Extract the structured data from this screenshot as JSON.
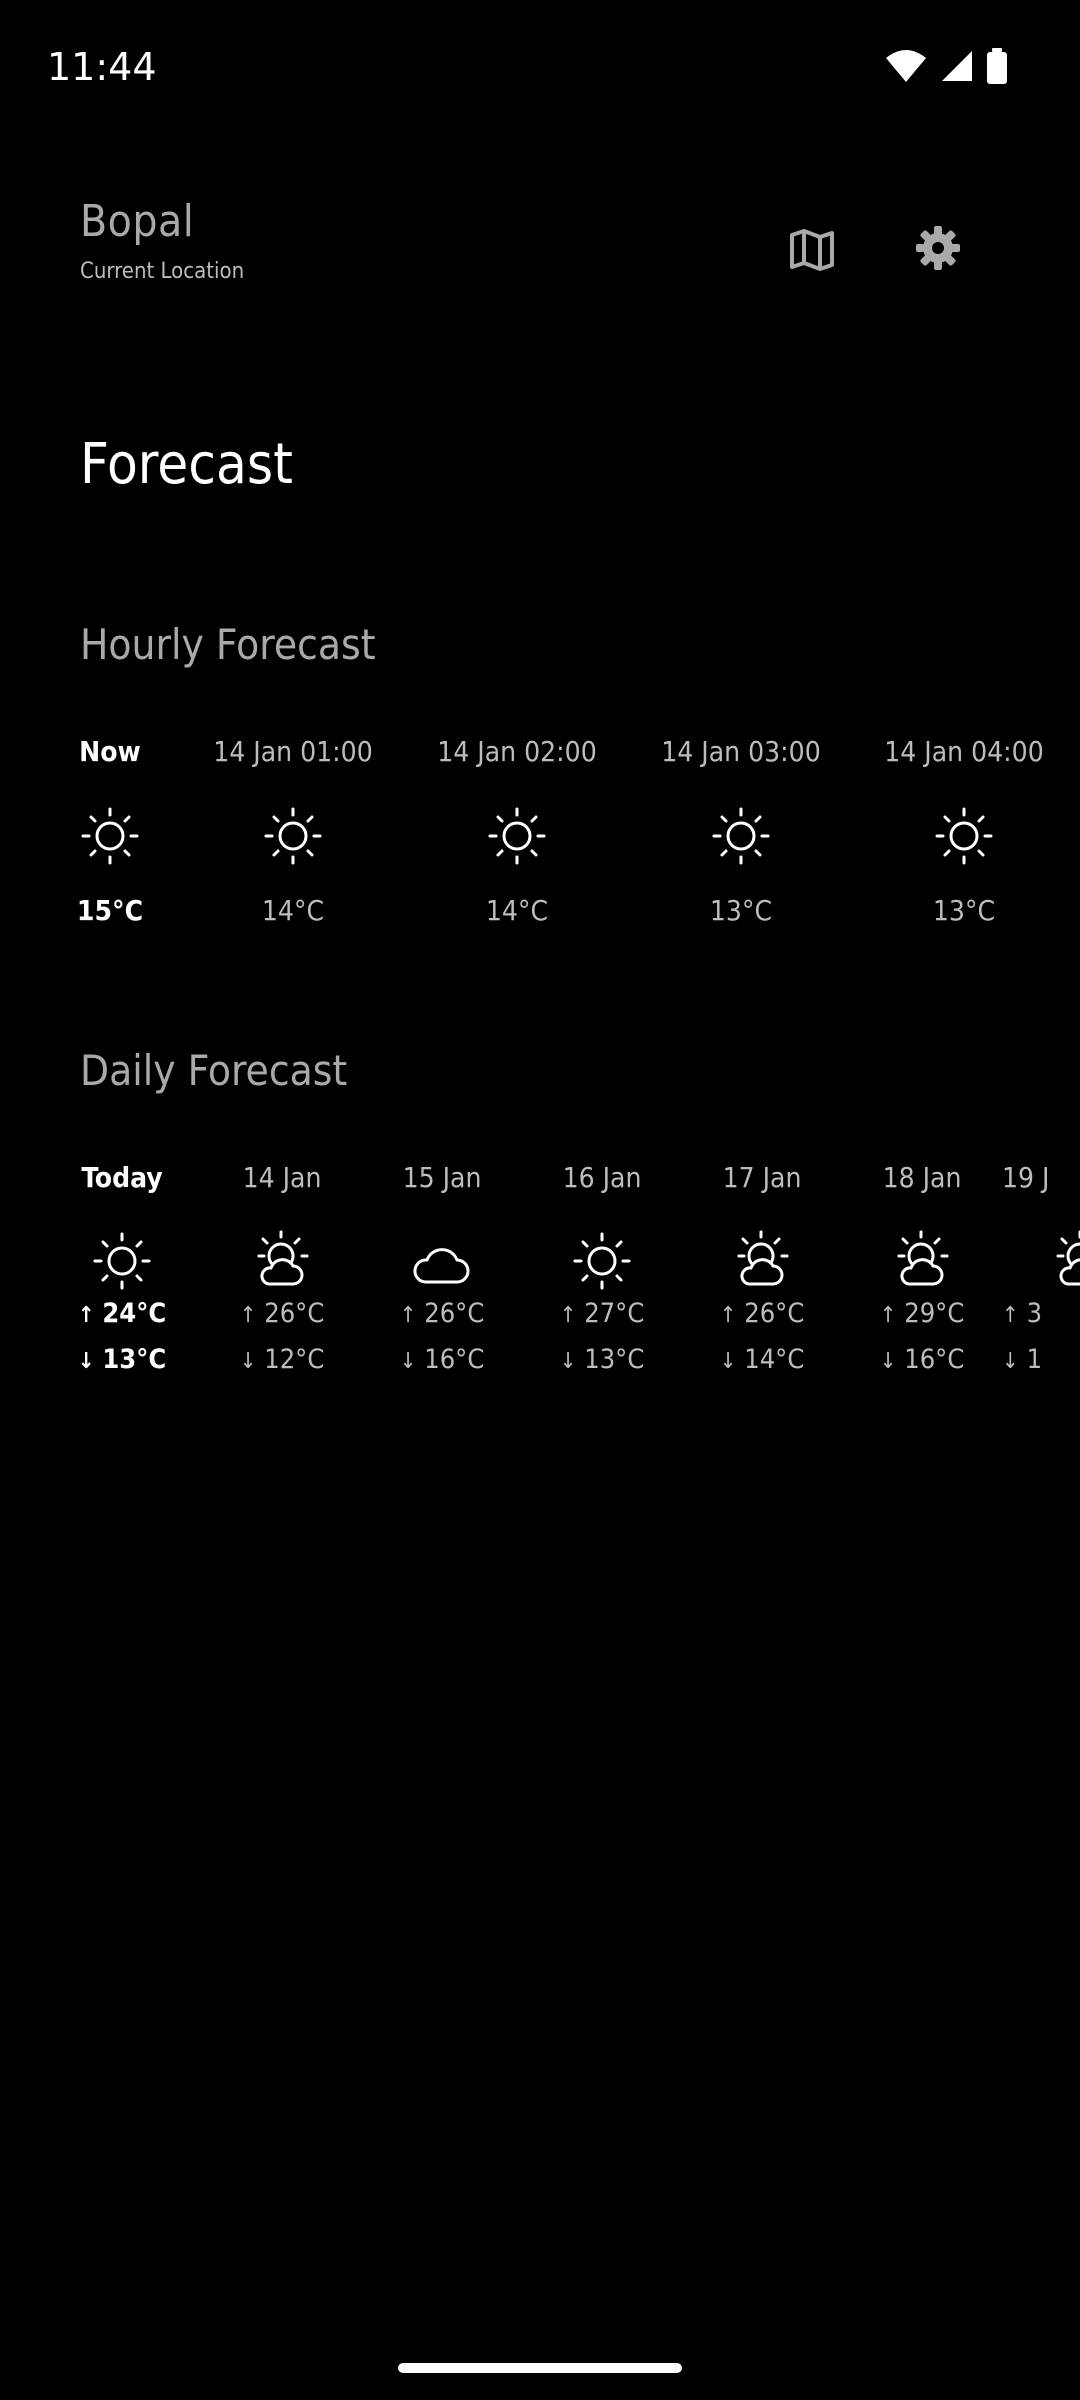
{
  "status_bar": {
    "time": "11:44",
    "icons": [
      "wifi-icon",
      "cellular-signal-icon",
      "battery-icon"
    ]
  },
  "header": {
    "location_name": "Bopal",
    "location_subtitle": "Current Location",
    "map_icon": "map-icon",
    "settings_icon": "gear-icon"
  },
  "page_title": "Forecast",
  "hourly": {
    "title": "Hourly Forecast",
    "items": [
      {
        "label": "Now",
        "temp": "15°C",
        "icon": "sunny-icon"
      },
      {
        "label": "14 Jan 01:00",
        "temp": "14°C",
        "icon": "sunny-icon"
      },
      {
        "label": "14 Jan 02:00",
        "temp": "14°C",
        "icon": "sunny-icon"
      },
      {
        "label": "14 Jan 03:00",
        "temp": "13°C",
        "icon": "sunny-icon"
      },
      {
        "label": "14 Jan 04:00",
        "temp": "13°C",
        "icon": "sunny-icon"
      }
    ]
  },
  "daily": {
    "title": "Daily Forecast",
    "items": [
      {
        "label": "Today",
        "high": "24°C",
        "low": "13°C",
        "icon": "sunny-icon"
      },
      {
        "label": "14 Jan",
        "high": "26°C",
        "low": "12°C",
        "icon": "partly-cloudy-icon"
      },
      {
        "label": "15 Jan",
        "high": "26°C",
        "low": "16°C",
        "icon": "cloudy-icon"
      },
      {
        "label": "16 Jan",
        "high": "27°C",
        "low": "13°C",
        "icon": "sunny-icon"
      },
      {
        "label": "17 Jan",
        "high": "26°C",
        "low": "14°C",
        "icon": "partly-cloudy-icon"
      },
      {
        "label": "18 Jan",
        "high": "29°C",
        "low": "16°C",
        "icon": "partly-cloudy-icon"
      },
      {
        "label": "19 J",
        "high": "3",
        "low": "1",
        "icon": "partly-cloudy-icon"
      }
    ]
  },
  "colors": {
    "background": "#000000",
    "primary_text": "#ffffff",
    "secondary_text": "#a9a9a9"
  }
}
